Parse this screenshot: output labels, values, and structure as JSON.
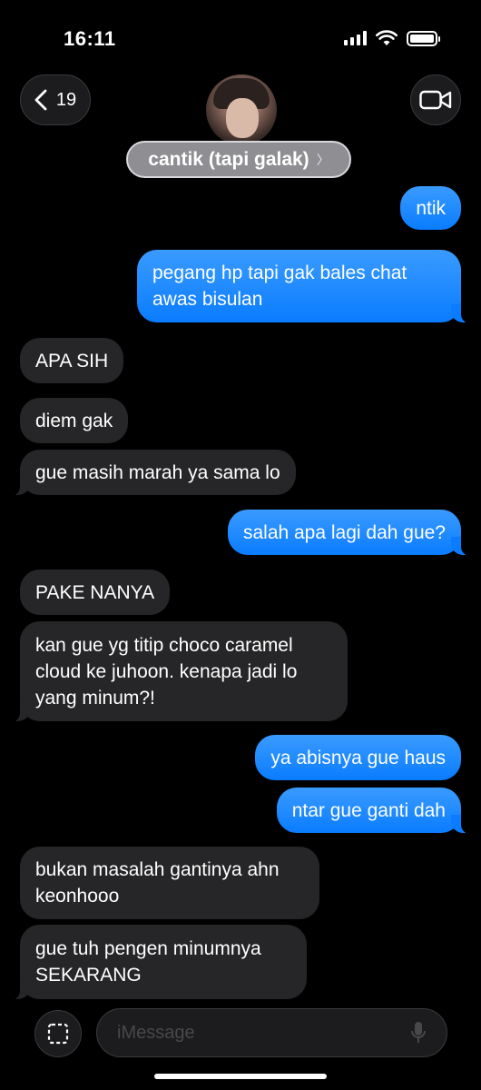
{
  "status": {
    "time": "16:11"
  },
  "header": {
    "back_count": "19",
    "contact_name": "cantik (tapi galak)",
    "chevron": "〉"
  },
  "messages": [
    {
      "side": "out",
      "lines": [
        "ntik"
      ]
    },
    {
      "side": "out",
      "lines": [
        "pegang hp tapi gak bales chat",
        "awas bisulan"
      ]
    },
    {
      "side": "in",
      "lines": [
        "APA SIH"
      ]
    },
    {
      "side": "in",
      "lines": [
        "diem gak"
      ]
    },
    {
      "side": "in",
      "lines": [
        "gue masih marah ya sama lo"
      ]
    },
    {
      "side": "out",
      "lines": [
        "salah apa lagi dah gue?"
      ]
    },
    {
      "side": "in",
      "lines": [
        "PAKE NANYA"
      ]
    },
    {
      "side": "in",
      "lines": [
        "kan gue yg titip choco caramel",
        "cloud ke juhoon. kenapa jadi lo",
        "yang minum?!"
      ]
    },
    {
      "side": "out",
      "lines": [
        "ya abisnya gue haus"
      ]
    },
    {
      "side": "out",
      "lines": [
        "ntar gue ganti dah"
      ]
    },
    {
      "side": "in",
      "lines": [
        "bukan masalah gantinya ahn",
        "keonhooo"
      ]
    },
    {
      "side": "in",
      "lines": [
        "gue tuh pengen minumnya",
        "SEKARANG"
      ]
    }
  ],
  "input": {
    "placeholder": "iMessage",
    "value": ""
  },
  "icons": {
    "back": "chevron-left-icon",
    "video": "video-camera-icon",
    "apps": "apps-icon",
    "mic": "microphone-icon",
    "wifi": "wifi-icon",
    "signal": "cellular-signal-icon",
    "battery": "battery-icon"
  },
  "colors": {
    "outgoing": "#0a7cff",
    "incoming": "#262628",
    "background": "#000000"
  }
}
